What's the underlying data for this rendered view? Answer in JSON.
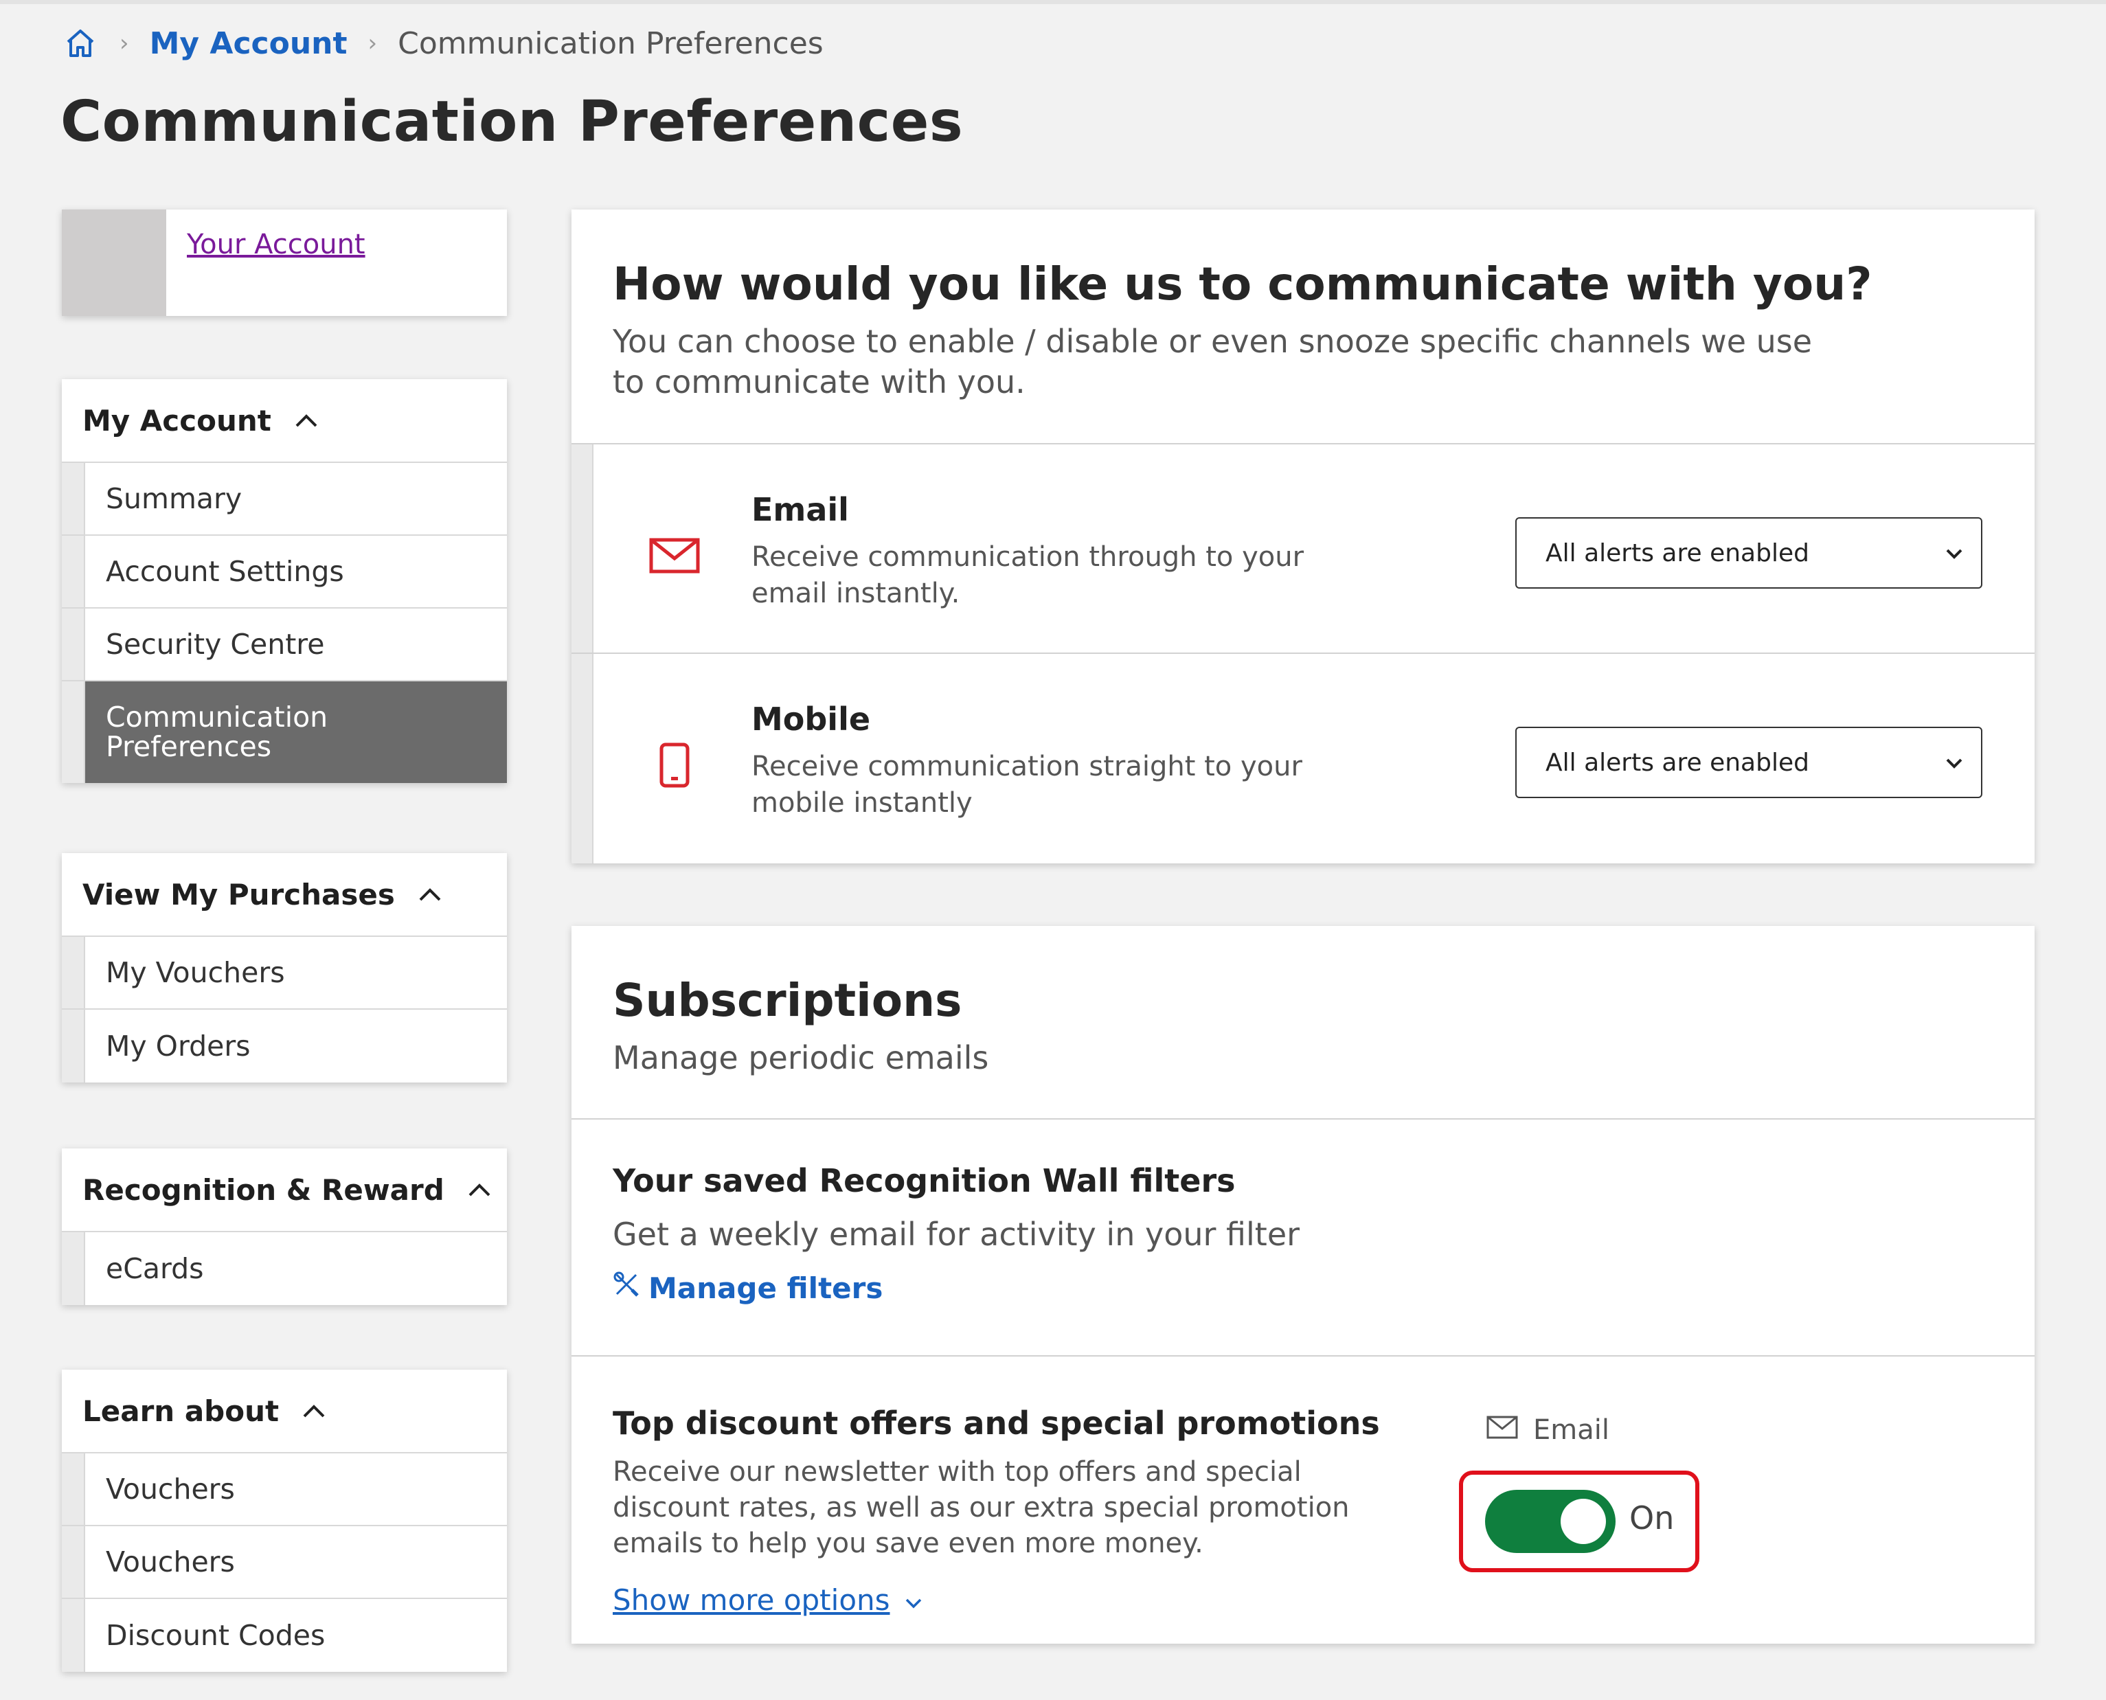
{
  "breadcrumb": {
    "home_icon": "home-icon",
    "items": [
      "My Account",
      "Communication Preferences"
    ]
  },
  "page": {
    "title": "Communication Preferences"
  },
  "account_card": {
    "link": "Your Account"
  },
  "sidebar": {
    "my_account": {
      "heading": "My Account",
      "items": [
        "Summary",
        "Account Settings",
        "Security Centre",
        "Communication Preferences"
      ],
      "active_index": 3
    },
    "purchases": {
      "heading": "View My Purchases",
      "items": [
        "My Vouchers",
        "My Orders"
      ]
    },
    "recognition": {
      "heading": "Recognition & Reward",
      "items": [
        "eCards"
      ]
    },
    "learn": {
      "heading": "Learn about",
      "items": [
        "Vouchers",
        "Vouchers",
        "Discount Codes"
      ]
    }
  },
  "channels": {
    "title": "How would you like us to communicate with you?",
    "subtitle": "You can choose to enable / disable or even snooze specific channels we use to communicate with you.",
    "email": {
      "title": "Email",
      "desc": "Receive communication through to your email instantly.",
      "selected": "All alerts are enabled",
      "icon": "mail-icon"
    },
    "mobile": {
      "title": "Mobile",
      "desc": "Receive communication straight to your mobile instantly",
      "selected": "All alerts are enabled",
      "icon": "mobile-phone-icon"
    }
  },
  "subscriptions": {
    "title": "Subscriptions",
    "subtitle": "Manage periodic emails",
    "recognition_filters": {
      "title": "Your saved Recognition Wall filters",
      "desc": "Get a weekly email for activity in your filter",
      "link": "Manage filters"
    },
    "promotions": {
      "title": "Top discount offers and special promotions",
      "desc": "Receive our newsletter with top offers and special discount rates, as well as our extra special promotion emails to help you save even more money.",
      "show_more": "Show more options",
      "channel": "Email",
      "toggle_state": "On",
      "toggle_on": true
    }
  },
  "colors": {
    "link": "#1a63c0",
    "visited_link": "#7a1a9a",
    "icon_red": "#d9262d",
    "toggle_green": "#0f7f3e",
    "highlight_red": "#e0101b",
    "active_nav": "#6b6b6b"
  }
}
